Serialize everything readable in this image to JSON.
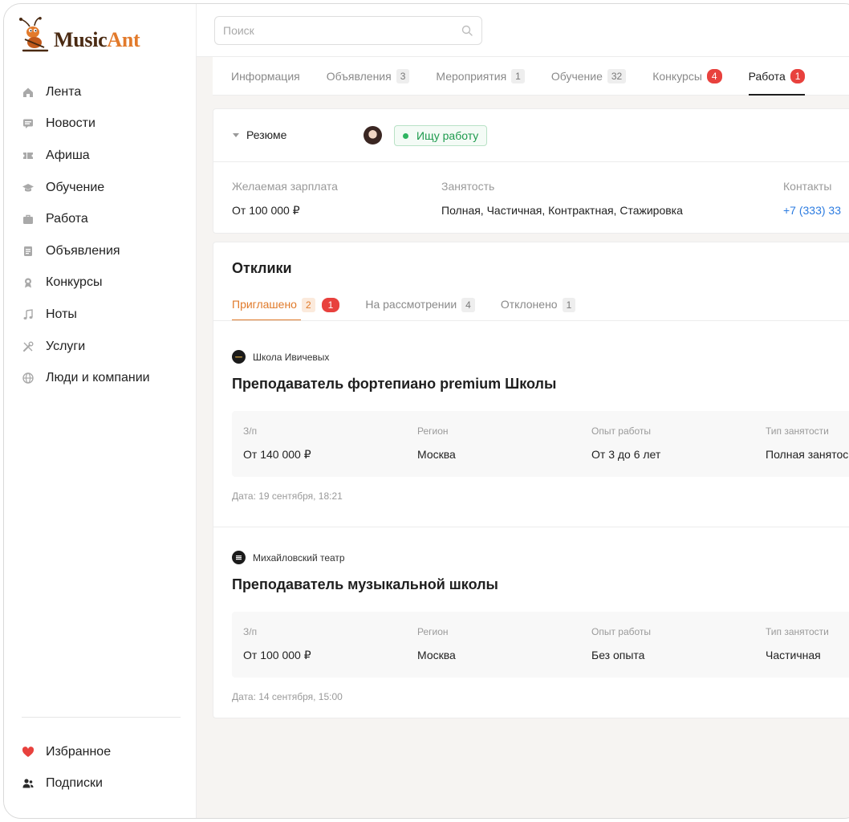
{
  "brand": {
    "name_part1": "Music",
    "name_part2": "Ant"
  },
  "search": {
    "placeholder": "Поиск"
  },
  "sidebar": {
    "items": [
      {
        "label": "Лента",
        "icon": "home-icon"
      },
      {
        "label": "Новости",
        "icon": "news-icon"
      },
      {
        "label": "Афиша",
        "icon": "ticket-icon"
      },
      {
        "label": "Обучение",
        "icon": "graduation-cap-icon"
      },
      {
        "label": "Работа",
        "icon": "briefcase-icon"
      },
      {
        "label": "Объявления",
        "icon": "notice-icon"
      },
      {
        "label": "Конкурсы",
        "icon": "award-icon"
      },
      {
        "label": "Ноты",
        "icon": "music-note-icon"
      },
      {
        "label": "Услуги",
        "icon": "tools-icon"
      },
      {
        "label": "Люди и компании",
        "icon": "globe-icon"
      }
    ],
    "bottom": [
      {
        "label": "Избранное",
        "icon": "heart-icon"
      },
      {
        "label": "Подписки",
        "icon": "users-icon"
      }
    ]
  },
  "tabs": [
    {
      "label": "Информация",
      "count": ""
    },
    {
      "label": "Объявления",
      "count": "3"
    },
    {
      "label": "Мероприятия",
      "count": "1"
    },
    {
      "label": "Обучение",
      "count": "32"
    },
    {
      "label": "Конкурсы",
      "count": "4"
    },
    {
      "label": "Работа",
      "count": "1"
    }
  ],
  "resume": {
    "toggle_label": "Резюме",
    "status": "Ищу работу",
    "salary_label": "Желаемая зарплата",
    "salary_value": "От 100 000 ₽",
    "employment_label": "Занятость",
    "employment_value": "Полная, Частичная, Контрактная, Стажировка",
    "contacts_label": "Контакты",
    "contacts_value": "+7 (333) 33"
  },
  "responses": {
    "title": "Отклики",
    "subtabs": [
      {
        "label": "Приглашено",
        "count": "2",
        "new": "1"
      },
      {
        "label": "На рассмотрении",
        "count": "4"
      },
      {
        "label": "Отклонено",
        "count": "1"
      }
    ],
    "param_labels": {
      "salary": "З/п",
      "region": "Регион",
      "experience": "Опыт работы",
      "employment": "Тип занятости"
    },
    "jobs": [
      {
        "org": "Школа Ивичевых",
        "title": "Преподаватель фортепиано premium Школы",
        "salary": "От 140 000 ₽",
        "region": "Москва",
        "experience": "От 3 до 6 лет",
        "employment": "Полная занятос",
        "date": "Дата: 19 сентября, 18:21"
      },
      {
        "org": "Михайловский театр",
        "title": "Преподаватель музыкальной школы",
        "salary": "От 100 000 ₽",
        "region": "Москва",
        "experience": "Без опыта",
        "employment": "Частичная",
        "date": "Дата: 14 сентября, 15:00"
      }
    ]
  },
  "colors": {
    "accent": "#e07a2a",
    "badge_red": "#e8413d",
    "status_green": "#1d9a4d",
    "link_blue": "#2b7be0"
  }
}
